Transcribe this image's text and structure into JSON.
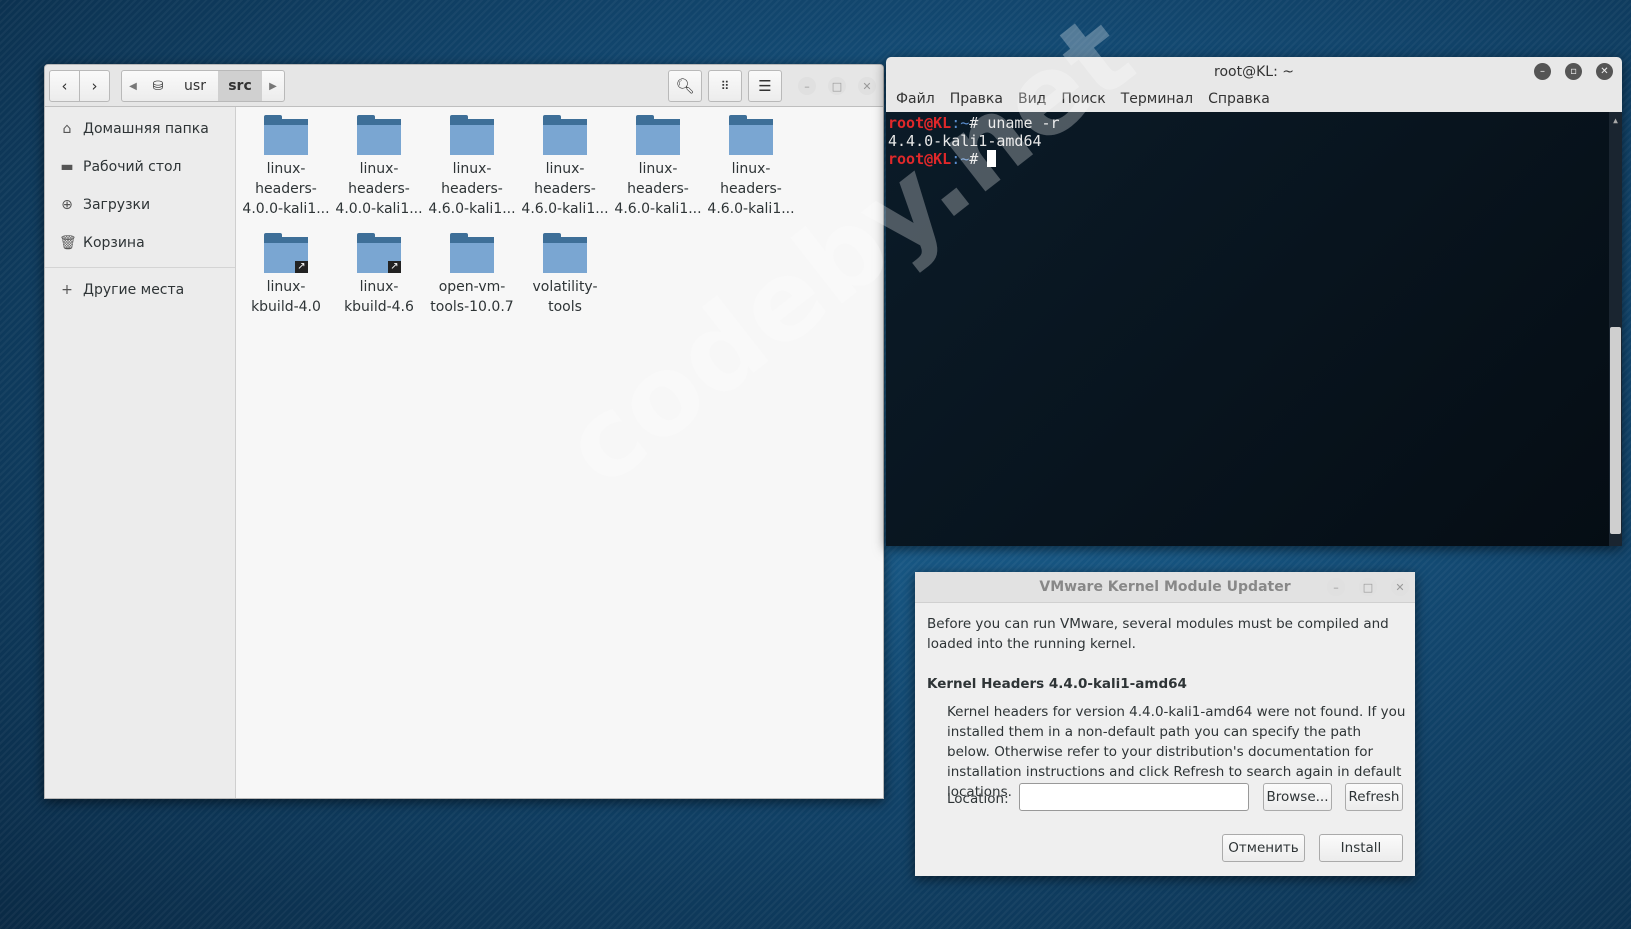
{
  "file_manager": {
    "path": [
      "usr",
      "src"
    ],
    "sidebar": [
      {
        "label": "Домашняя папка",
        "icon": "home-icon"
      },
      {
        "label": "Рабочий стол",
        "icon": "desktop-icon"
      },
      {
        "label": "Загрузки",
        "icon": "download-icon"
      },
      {
        "label": "Корзина",
        "icon": "trash-icon"
      },
      {
        "label": "Другие места",
        "icon": "plus-icon"
      }
    ],
    "items": [
      {
        "l1": "linux-",
        "l2": "headers-",
        "l3": "4.0.0-kali1..."
      },
      {
        "l1": "linux-",
        "l2": "headers-",
        "l3": "4.0.0-kali1..."
      },
      {
        "l1": "linux-",
        "l2": "headers-",
        "l3": "4.6.0-kali1..."
      },
      {
        "l1": "linux-",
        "l2": "headers-",
        "l3": "4.6.0-kali1..."
      },
      {
        "l1": "linux-",
        "l2": "headers-",
        "l3": "4.6.0-kali1..."
      },
      {
        "l1": "linux-",
        "l2": "headers-",
        "l3": "4.6.0-kali1..."
      },
      {
        "l1": "linux-",
        "l2": "kbuild-4.0",
        "link": true
      },
      {
        "l1": "linux-",
        "l2": "kbuild-4.6",
        "link": true
      },
      {
        "l1": "open-vm-",
        "l2": "tools-10.0.7"
      },
      {
        "l1": "volatility-",
        "l2": "tools"
      }
    ]
  },
  "terminal": {
    "title": "root@KL: ~",
    "menu": [
      "Файл",
      "Правка",
      "Вид",
      "Поиск",
      "Терминал",
      "Справка"
    ],
    "prompt_user": "root@KL",
    "prompt_path": ":~",
    "prompt_sym": "# ",
    "command": "uname -r",
    "output": "4.4.0-kali1-amd64"
  },
  "dialog": {
    "title": "VMware Kernel Module Updater",
    "intro": "Before you can run VMware, several modules must be compiled and loaded into the running kernel.",
    "heading": "Kernel Headers 4.4.0-kali1-amd64",
    "body": "Kernel headers for version 4.4.0-kali1-amd64 were not found.  If you installed them in a non-default path you can specify the path below. Otherwise refer to your distribution's documentation for installation instructions and click Refresh to search again in default locations.",
    "location_label": "Location:",
    "location_value": "",
    "browse": "Browse...",
    "refresh": "Refresh",
    "cancel": "Отменить",
    "install": "Install"
  },
  "watermark": "codeby.net"
}
